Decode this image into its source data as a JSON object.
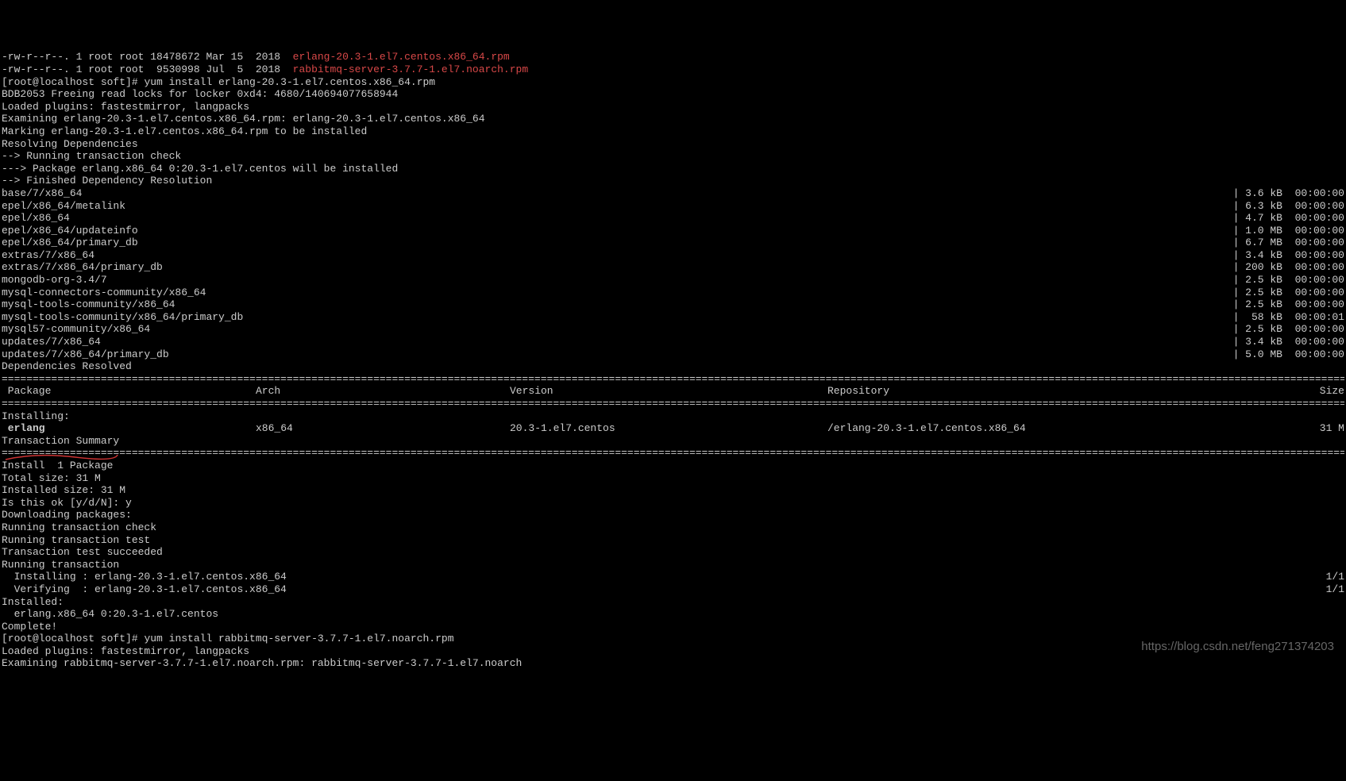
{
  "ls": [
    {
      "perms": "-rw-r--r--. 1 root root 18478672 Mar 15  2018  ",
      "file": "erlang-20.3-1.el7.centos.x86_64.rpm"
    },
    {
      "perms": "-rw-r--r--. 1 root root  9530998 Jul  5  2018  ",
      "file": "rabbitmq-server-3.7.7-1.el7.noarch.rpm"
    }
  ],
  "prompt1": {
    "prefix": "[root@localhost soft]# ",
    "cmd": "yum install erlang-20.3-1.el7.centos.x86_64.rpm"
  },
  "yum_pre": [
    "BDB2053 Freeing read locks for locker 0xd4: 4680/140694077658944",
    "Loaded plugins: fastestmirror, langpacks",
    "Examining erlang-20.3-1.el7.centos.x86_64.rpm: erlang-20.3-1.el7.centos.x86_64",
    "Marking erlang-20.3-1.el7.centos.x86_64.rpm to be installed",
    "Resolving Dependencies",
    "--> Running transaction check",
    "---> Package erlang.x86_64 0:20.3-1.el7.centos will be installed",
    "--> Finished Dependency Resolution"
  ],
  "repos": [
    {
      "name": "base/7/x86_64",
      "size": "| 3.6 kB  00:00:00"
    },
    {
      "name": "epel/x86_64/metalink",
      "size": "| 6.3 kB  00:00:00"
    },
    {
      "name": "epel/x86_64",
      "size": "| 4.7 kB  00:00:00"
    },
    {
      "name": "epel/x86_64/updateinfo",
      "size": "| 1.0 MB  00:00:00"
    },
    {
      "name": "epel/x86_64/primary_db",
      "size": "| 6.7 MB  00:00:00"
    },
    {
      "name": "extras/7/x86_64",
      "size": "| 3.4 kB  00:00:00"
    },
    {
      "name": "extras/7/x86_64/primary_db",
      "size": "| 200 kB  00:00:00"
    },
    {
      "name": "mongodb-org-3.4/7",
      "size": "| 2.5 kB  00:00:00"
    },
    {
      "name": "mysql-connectors-community/x86_64",
      "size": "| 2.5 kB  00:00:00"
    },
    {
      "name": "mysql-tools-community/x86_64",
      "size": "| 2.5 kB  00:00:00"
    },
    {
      "name": "mysql-tools-community/x86_64/primary_db",
      "size": "|  58 kB  00:00:01"
    },
    {
      "name": "mysql57-community/x86_64",
      "size": "| 2.5 kB  00:00:00"
    },
    {
      "name": "updates/7/x86_64",
      "size": "| 3.4 kB  00:00:00"
    },
    {
      "name": "updates/7/x86_64/primary_db",
      "size": "| 5.0 MB  00:00:00"
    }
  ],
  "deps_resolved": "Dependencies Resolved",
  "table": {
    "headers": {
      "package": " Package",
      "arch": "Arch",
      "version": "Version",
      "repo": "Repository",
      "size": "Size"
    },
    "installing_label": "Installing:",
    "row": {
      "package": " erlang",
      "arch": "x86_64",
      "version": "20.3-1.el7.centos",
      "repo": "/erlang-20.3-1.el7.centos.x86_64",
      "size": "31 M"
    }
  },
  "trans_summary": "Transaction Summary",
  "install_count": "Install  1 Package",
  "sizes": [
    "Total size: 31 M",
    "Installed size: 31 M",
    "Is this ok [y/d/N]: y",
    "Downloading packages:",
    "Running transaction check",
    "Running transaction test",
    "Transaction test succeeded",
    "Running transaction"
  ],
  "progress": [
    {
      "left": "  Installing : erlang-20.3-1.el7.centos.x86_64",
      "right": "1/1"
    },
    {
      "left": "  Verifying  : erlang-20.3-1.el7.centos.x86_64",
      "right": "1/1"
    }
  ],
  "installed_label": "Installed:",
  "installed_pkg": "  erlang.x86_64 0:20.3-1.el7.centos",
  "complete": "Complete!",
  "prompt2": {
    "prefix": "[root@localhost soft]# ",
    "cmd": "yum install rabbitmq-server-3.7.7-1.el7.noarch.rpm"
  },
  "yum_post": [
    "Loaded plugins: fastestmirror, langpacks",
    "Examining rabbitmq-server-3.7.7-1.el7.noarch.rpm: rabbitmq-server-3.7.7-1.el7.noarch"
  ],
  "watermark": "https://blog.csdn.net/feng271374203",
  "hr": "================================================================================================================================================================================================================================================================"
}
